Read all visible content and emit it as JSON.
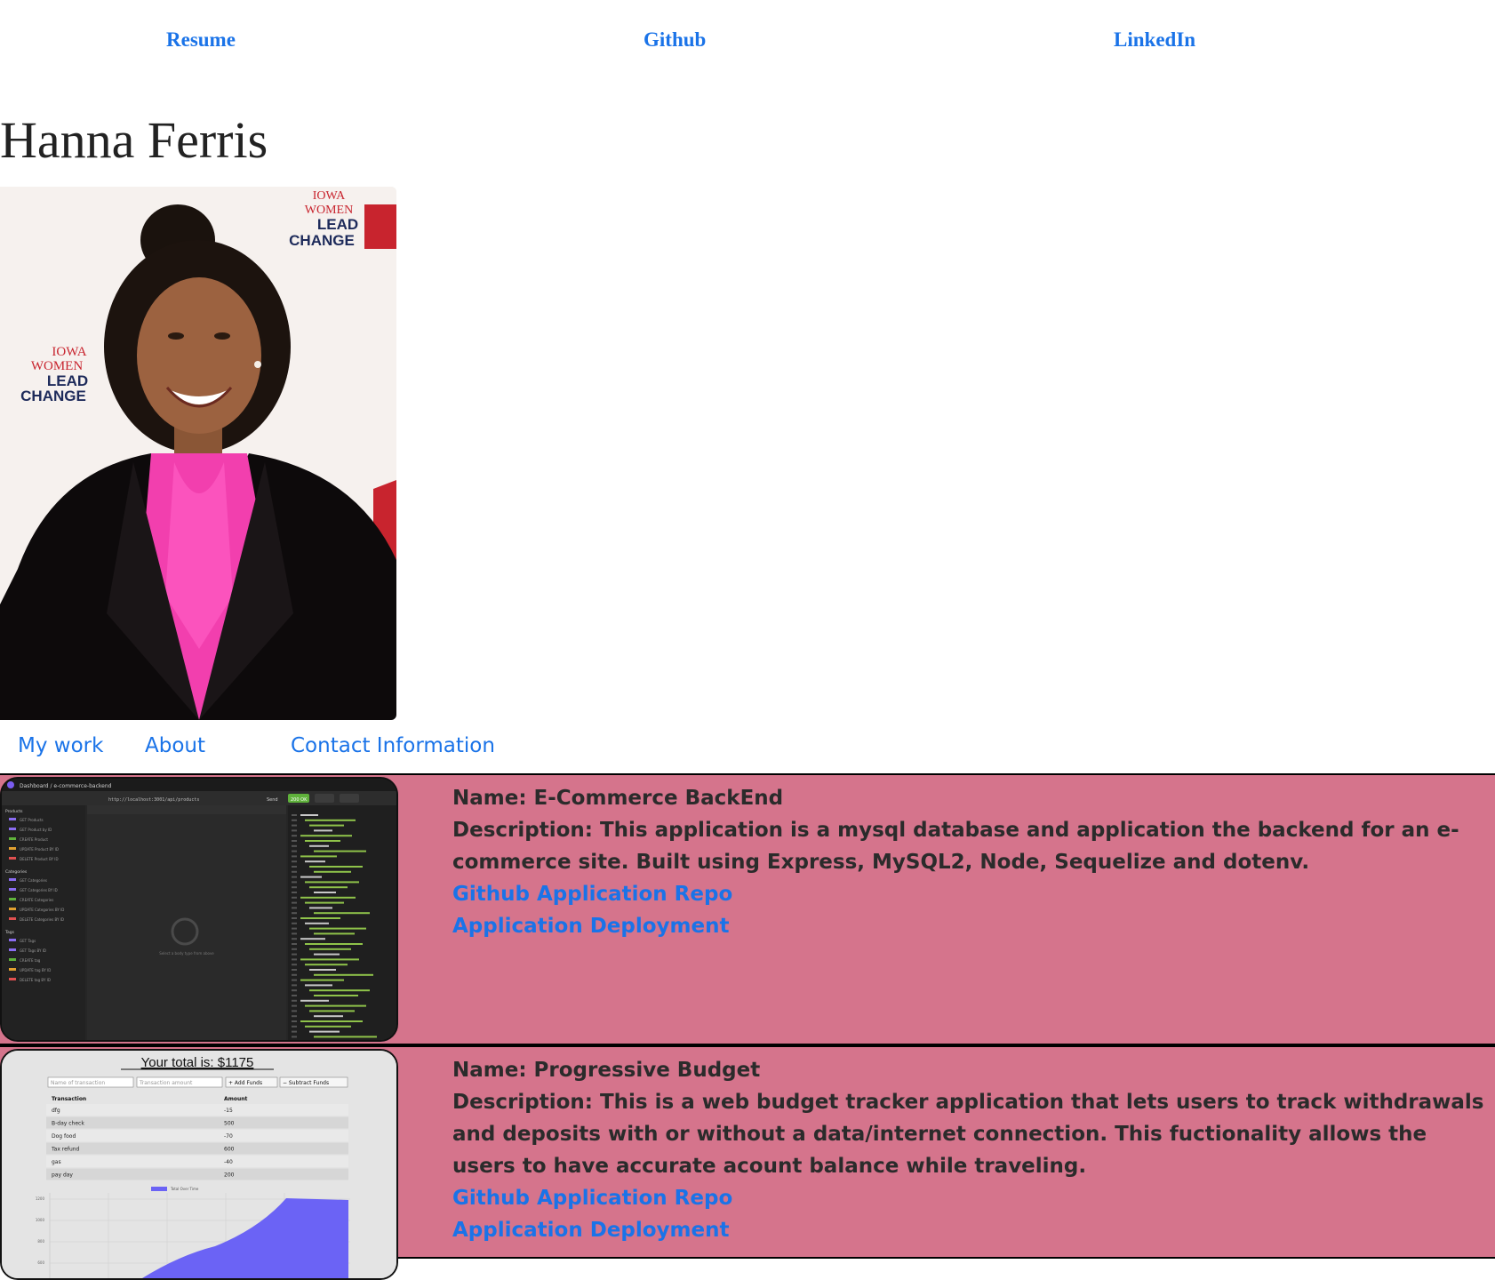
{
  "top_nav": {
    "resume": "Resume",
    "github": "Github",
    "linkedin": "LinkedIn"
  },
  "profile": {
    "name": "Hanna Ferris",
    "backdrop_text": [
      "IOWA",
      "WOMEN",
      "LEAD",
      "CHANGE"
    ]
  },
  "sub_nav": {
    "my_work": "My work",
    "about": "About",
    "contact": "Contact Information"
  },
  "projects": [
    {
      "name": "Name: E-Commerce BackEnd",
      "description": "Description: This application is a mysql database and application the backend for an e-commerce site. Built using Express, MySQL2, Node, Sequelize and dotenv.",
      "repo_link": "Github Application Repo",
      "deploy_link": "Application Deployment",
      "screenshot": {
        "breadcrumb": "Dashboard / e-commerce-backend",
        "url": "http://localhost:3001/api/products",
        "send": "Send",
        "status": "200 OK",
        "sidebar_groups": [
          {
            "title": "Products",
            "items": [
              "GET Products",
              "GET Product by ID",
              "CREATE Product",
              "UPDATE Product BY ID",
              "DELETE Product BY ID"
            ]
          },
          {
            "title": "Categories",
            "items": [
              "GET Categories",
              "GET Categories BY ID",
              "CREATE Categories",
              "UPDATE Categories BY ID",
              "DELETE Categories BY ID"
            ]
          },
          {
            "title": "Tags",
            "items": [
              "GET Tags",
              "GET Tags BY ID",
              "CREATE tag",
              "UPDATE tag BY ID",
              "DELETE tag BY ID"
            ]
          }
        ],
        "empty_body_text": "Select a body type from above"
      }
    },
    {
      "name": "Name: Progressive Budget",
      "description": "Description: This is a web budget tracker application that lets users to track withdrawals and deposits with or without a data/internet connection. This fuctionality allows the users to have accurate acount balance while traveling.",
      "repo_link": "Github Application Repo",
      "deploy_link": "Application Deployment",
      "screenshot": {
        "total": "Your total is: $1175",
        "name_placeholder": "Name of transaction",
        "amount_placeholder": "Transaction amount",
        "add_button": "+ Add Funds",
        "subtract_button": "− Subtract Funds",
        "table_headers": [
          "Transaction",
          "Amount"
        ],
        "rows": [
          [
            "dfg",
            "-15"
          ],
          [
            "B-day check",
            "500"
          ],
          [
            "Dog food",
            "-70"
          ],
          [
            "Tax refund",
            "600"
          ],
          [
            "gas",
            "-40"
          ],
          [
            "pay day",
            "200"
          ]
        ],
        "chart_legend": "Total Over Time",
        "chart_ticks": [
          "1200",
          "1000",
          "800",
          "600"
        ]
      }
    }
  ],
  "colors": {
    "link": "#1a73e8",
    "card_bg": "#d5748c",
    "chart_fill": "#6b63f5"
  }
}
